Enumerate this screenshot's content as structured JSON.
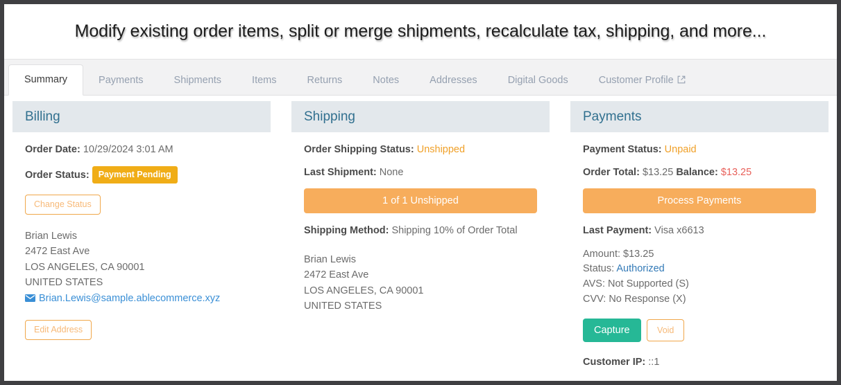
{
  "banner": {
    "title": "Modify existing order items, split or merge shipments, recalculate tax, shipping, and more..."
  },
  "tabs": [
    {
      "label": "Summary",
      "active": true
    },
    {
      "label": "Payments",
      "active": false
    },
    {
      "label": "Shipments",
      "active": false
    },
    {
      "label": "Items",
      "active": false
    },
    {
      "label": "Returns",
      "active": false
    },
    {
      "label": "Notes",
      "active": false
    },
    {
      "label": "Addresses",
      "active": false
    },
    {
      "label": "Digital Goods",
      "active": false
    },
    {
      "label": "Customer Profile",
      "active": false,
      "icon": "external-link-icon"
    }
  ],
  "billing": {
    "heading": "Billing",
    "order_date_label": "Order Date:",
    "order_date_value": "10/29/2024 3:01 AM",
    "order_status_label": "Order Status:",
    "order_status_badge": "Payment Pending",
    "change_status_button": "Change Status",
    "address": {
      "name": "Brian Lewis",
      "street": "2472 East Ave",
      "city_state_zip": "LOS ANGELES, CA 90001",
      "country": "UNITED STATES",
      "email": "Brian.Lewis@sample.ablecommerce.xyz",
      "email_icon": "envelope-icon"
    },
    "edit_address_button": "Edit Address"
  },
  "shipping": {
    "heading": "Shipping",
    "status_label": "Order Shipping Status:",
    "status_value": "Unshipped",
    "last_shipment_label": "Last Shipment:",
    "last_shipment_value": "None",
    "unshipped_button": "1 of 1 Unshipped",
    "method_label": "Shipping Method:",
    "method_value": "Shipping 10% of Order Total",
    "address": {
      "name": "Brian Lewis",
      "street": "2472 East Ave",
      "city_state_zip": "LOS ANGELES, CA 90001",
      "country": "UNITED STATES"
    }
  },
  "payments": {
    "heading": "Payments",
    "payment_status_label": "Payment Status:",
    "payment_status_value": "Unpaid",
    "order_total_label": "Order Total:",
    "order_total_value": "$13.25",
    "balance_label": "Balance:",
    "balance_value": "$13.25",
    "process_payments_button": "Process Payments",
    "last_payment_label": "Last Payment:",
    "last_payment_value": "Visa x6613",
    "amount_line": "Amount: $13.25",
    "status_prefix": "Status:",
    "status_link": "Authorized",
    "avs_line": "AVS: Not Supported (S)",
    "cvv_line": "CVV: No Response (X)",
    "capture_button": "Capture",
    "void_button": "Void",
    "customer_ip_label": "Customer IP:",
    "customer_ip_value": "::1"
  },
  "colors": {
    "frame": "#3f3f42",
    "panel_header_bg": "#e3e8ec",
    "panel_heading_text": "#31708f",
    "badge_amber": "#f0ad17",
    "button_orange": "#f7ad5c",
    "button_teal": "#26b896",
    "balance_red": "#e8605a",
    "link_blue": "#337ab7",
    "tab_inactive": "#95a0b0"
  }
}
